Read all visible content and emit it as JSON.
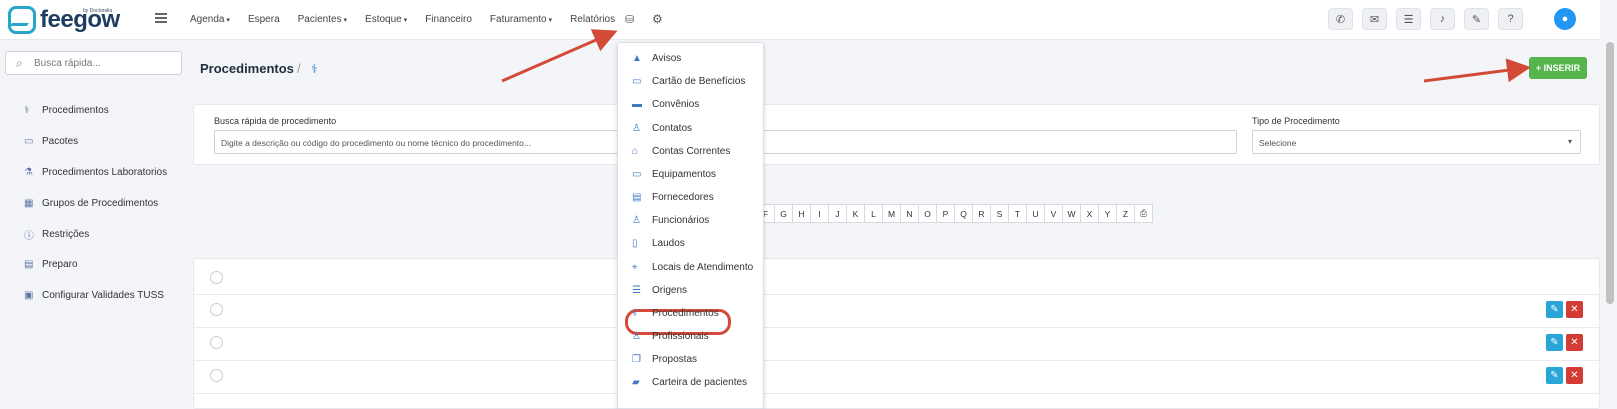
{
  "brand": {
    "name": "feegow",
    "tagline": "by Doctoralia"
  },
  "topnav": [
    "Agenda",
    "Espera",
    "Pacientes",
    "Estoque",
    "Financeiro",
    "Faturamento",
    "Relatórios"
  ],
  "search": {
    "placeholder": "Busca rápida..."
  },
  "sidebar": {
    "items": [
      {
        "label": "Procedimentos",
        "icon": "stethoscope-icon"
      },
      {
        "label": "Pacotes",
        "icon": "box-icon"
      },
      {
        "label": "Procedimentos Laboratorios",
        "icon": "flask-icon"
      },
      {
        "label": "Grupos de Procedimentos",
        "icon": "grid-icon"
      },
      {
        "label": "Restrições",
        "icon": "info-icon"
      },
      {
        "label": "Preparo",
        "icon": "list-icon"
      },
      {
        "label": "Configurar Validades TUSS",
        "icon": "calendar-icon"
      }
    ]
  },
  "page": {
    "title": "Procedimentos",
    "separator": "/"
  },
  "insert_button": "+ INSERIR",
  "filters": {
    "search_label": "Busca rápida de procedimento",
    "search_placeholder": "Digite a descrição ou código do procedimento ou nome técnico do procedimento...",
    "type_label": "Tipo de Procedimento",
    "type_selected": "Selecione"
  },
  "alphabet": [
    "F",
    "G",
    "H",
    "I",
    "J",
    "K",
    "L",
    "M",
    "N",
    "O",
    "P",
    "Q",
    "R",
    "S",
    "T",
    "U",
    "V",
    "W",
    "X",
    "Y",
    "Z"
  ],
  "dropdown": {
    "items": [
      {
        "label": "Avisos",
        "icon": "warning-icon"
      },
      {
        "label": "Cartão de Benefícios",
        "icon": "id-card-icon"
      },
      {
        "label": "Convênios",
        "icon": "credit-card-icon"
      },
      {
        "label": "Contatos",
        "icon": "user-icon"
      },
      {
        "label": "Contas Correntes",
        "icon": "bank-icon"
      },
      {
        "label": "Equipamentos",
        "icon": "laptop-icon"
      },
      {
        "label": "Fornecedores",
        "icon": "archive-icon"
      },
      {
        "label": "Funcionários",
        "icon": "user-icon"
      },
      {
        "label": "Laudos",
        "icon": "document-icon"
      },
      {
        "label": "Locais de Atendimento",
        "icon": "map-pin-icon"
      },
      {
        "label": "Origens",
        "icon": "list-icon"
      },
      {
        "label": "Procedimentos",
        "icon": "stethoscope-icon"
      },
      {
        "label": "Profissionais",
        "icon": "doctor-icon"
      },
      {
        "label": "Propostas",
        "icon": "copy-icon"
      },
      {
        "label": "Carteira de pacientes",
        "icon": "book-icon"
      }
    ]
  },
  "colors": {
    "accent": "#2f7ed8",
    "insert": "#55b44d",
    "highlight": "#d44a38",
    "edit": "#2aa5d8",
    "delete": "#d33b35"
  }
}
